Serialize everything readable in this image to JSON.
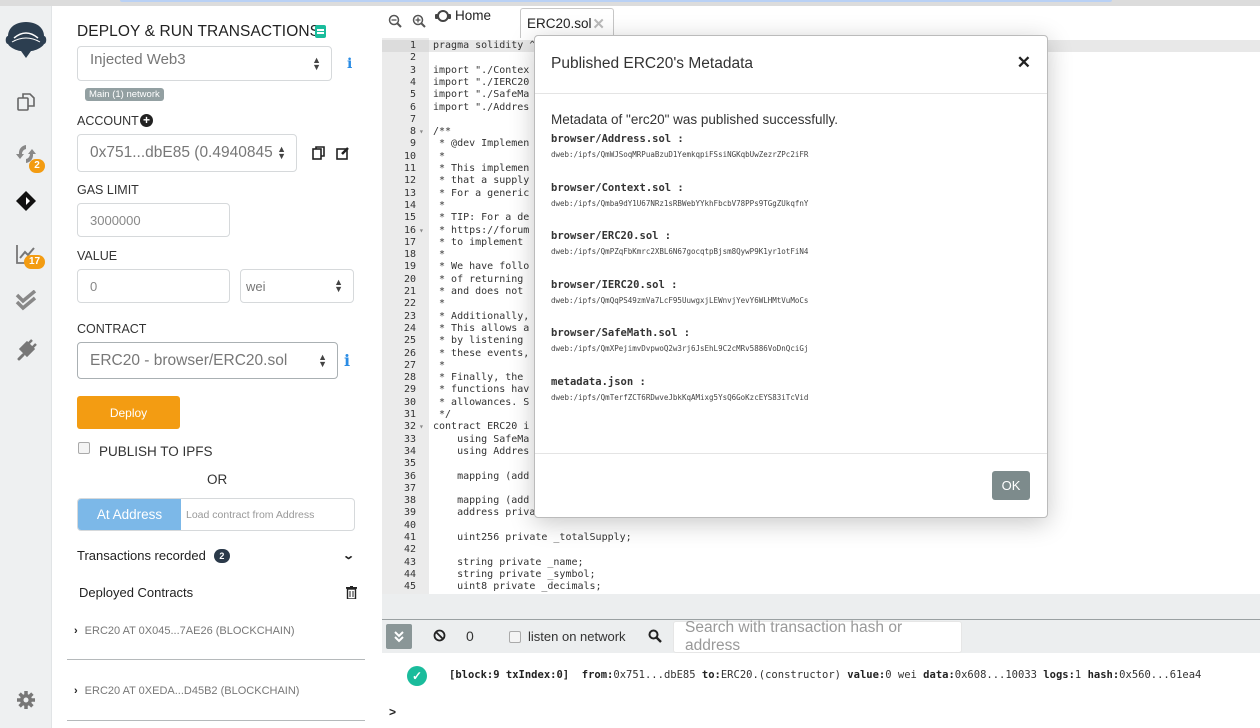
{
  "iconbar": {
    "compile_badge": "2",
    "analysis_badge": "17"
  },
  "panel": {
    "title": "DEPLOY & RUN TRANSACTIONS",
    "environment": "Injected Web3",
    "network_badge": "Main (1) network",
    "account_label": "ACCOUNT",
    "account_value": "0x751...dbE85 (0.4940845",
    "gas_limit_label": "GAS LIMIT",
    "gas_limit_value": "3000000",
    "value_label": "VALUE",
    "value_value": "0",
    "value_unit": "wei",
    "contract_label": "CONTRACT",
    "contract_value": "ERC20 - browser/ERC20.sol",
    "deploy_label": "Deploy",
    "publish_label": "PUBLISH TO IPFS",
    "or_label": "OR",
    "at_address_label": "At Address",
    "at_address_placeholder": "Load contract from Address",
    "transactions_recorded_label": "Transactions recorded",
    "transactions_recorded_count": "2",
    "deployed_contracts_label": "Deployed Contracts",
    "deployed": [
      {
        "label": "ERC20 AT 0X045...7AE26 (BLOCKCHAIN)"
      },
      {
        "label": "ERC20 AT 0XEDA...D45B2 (BLOCKCHAIN)"
      }
    ]
  },
  "tabs": {
    "home_label": "Home",
    "file_label": "ERC20.sol"
  },
  "editor": {
    "lines": [
      {
        "n": "1",
        "code": "pragma solidity ^",
        "kw": true
      },
      {
        "n": "2",
        "code": ""
      },
      {
        "n": "3",
        "code": "import \"./Contex",
        "kw": true
      },
      {
        "n": "4",
        "code": "import \"./IERC20",
        "kw": true
      },
      {
        "n": "5",
        "code": "import \"./SafeMa",
        "kw": true
      },
      {
        "n": "6",
        "code": "import \"./Addres",
        "kw": true
      },
      {
        "n": "7",
        "code": ""
      },
      {
        "n": "8",
        "code": "/**",
        "fold": true
      },
      {
        "n": "9",
        "code": " * @dev Implemen"
      },
      {
        "n": "10",
        "code": " *"
      },
      {
        "n": "11",
        "code": " * This implemen"
      },
      {
        "n": "12",
        "code": " * that a supply"
      },
      {
        "n": "13",
        "code": " * For a generic"
      },
      {
        "n": "14",
        "code": " *"
      },
      {
        "n": "15",
        "code": " * TIP: For a de"
      },
      {
        "n": "16",
        "code": " * https://forum",
        "fold": true
      },
      {
        "n": "17",
        "code": " * to implement "
      },
      {
        "n": "18",
        "code": " *"
      },
      {
        "n": "19",
        "code": " * We have follo"
      },
      {
        "n": "20",
        "code": " * of returning "
      },
      {
        "n": "21",
        "code": " * and does not "
      },
      {
        "n": "22",
        "code": " *"
      },
      {
        "n": "23",
        "code": " * Additionally,"
      },
      {
        "n": "24",
        "code": " * This allows a"
      },
      {
        "n": "25",
        "code": " * by listening "
      },
      {
        "n": "26",
        "code": " * these events,"
      },
      {
        "n": "27",
        "code": " *"
      },
      {
        "n": "28",
        "code": " * Finally, the "
      },
      {
        "n": "29",
        "code": " * functions hav"
      },
      {
        "n": "30",
        "code": " * allowances. S"
      },
      {
        "n": "31",
        "code": " */"
      },
      {
        "n": "32",
        "code": "contract ERC20 i",
        "fold": true,
        "kw": true
      },
      {
        "n": "33",
        "code": "    using SafeMa",
        "kw": true
      },
      {
        "n": "34",
        "code": "    using Addres",
        "kw": true
      },
      {
        "n": "35",
        "code": ""
      },
      {
        "n": "36",
        "code": "    mapping (add",
        "kw": true
      },
      {
        "n": "37",
        "code": ""
      },
      {
        "n": "38",
        "code": "    mapping (add",
        "kw": true
      },
      {
        "n": "39",
        "code": "    address priva",
        "kw": true
      },
      {
        "n": "40",
        "code": ""
      },
      {
        "n": "41",
        "code": "    uint256 private _totalSupply;",
        "kw": true
      },
      {
        "n": "42",
        "code": ""
      },
      {
        "n": "43",
        "code": "    string private _name;",
        "kw": true
      },
      {
        "n": "44",
        "code": "    string private _symbol;",
        "kw": true
      },
      {
        "n": "45",
        "code": "    uint8 private _decimals;",
        "kw": true
      }
    ]
  },
  "terminal": {
    "pending_count": "0",
    "listen_label": "listen on network",
    "search_placeholder": "Search with transaction hash or address",
    "tx": {
      "block": "[block:9 txIndex:0]",
      "from_label": "from:",
      "from": "0x751...dbE85",
      "to_label": "to:",
      "to": "ERC20.(constructor)",
      "value_label": "value:",
      "value": "0 wei",
      "data_label": "data:",
      "data": "0x608...10033",
      "logs_label": "logs:",
      "logs": "1",
      "hash_label": "hash:",
      "hash": "0x560...61ea4"
    },
    "prompt": ">"
  },
  "modal": {
    "title": "Published ERC20's Metadata",
    "message": "Metadata of \"erc20\" was published successfully.",
    "entries": [
      {
        "file": "browser/Address.sol :",
        "url": "dweb:/ipfs/QmWJSoqMRPuaBzuD1YemkqpiFSsiNGKqbUwZezrZPc2iFR"
      },
      {
        "file": "browser/Context.sol :",
        "url": "dweb:/ipfs/Qmba9dY1U67NRz1sRBWebYYkhFbcbV78PPs9TGgZUkqfnY"
      },
      {
        "file": "browser/ERC20.sol :",
        "url": "dweb:/ipfs/QmPZqFbKmrc2XBL6N67gocqtpBjsm8QywP9K1yr1otFiN4"
      },
      {
        "file": "browser/IERC20.sol :",
        "url": "dweb:/ipfs/QmQqPS49zmVa7LcF95UuwgxjLEWnvjYevY6WLHMtVuMoCs"
      },
      {
        "file": "browser/SafeMath.sol :",
        "url": "dweb:/ipfs/QmXPejimvDvpwoQ2w3rj6JsEhL9C2cMRv5886VoDnQciGj"
      },
      {
        "file": "metadata.json :",
        "url": "dweb:/ipfs/QmTerfZCT6RDwveJbkKqAMixg5YsQ6GoKzcEYS83iTcVid"
      }
    ],
    "ok_label": "OK"
  },
  "colors": {
    "deploy": "#f39c12",
    "at_address": "#7cb8e8",
    "success": "#1abc9c",
    "ok_button": "#7d8b8c"
  }
}
